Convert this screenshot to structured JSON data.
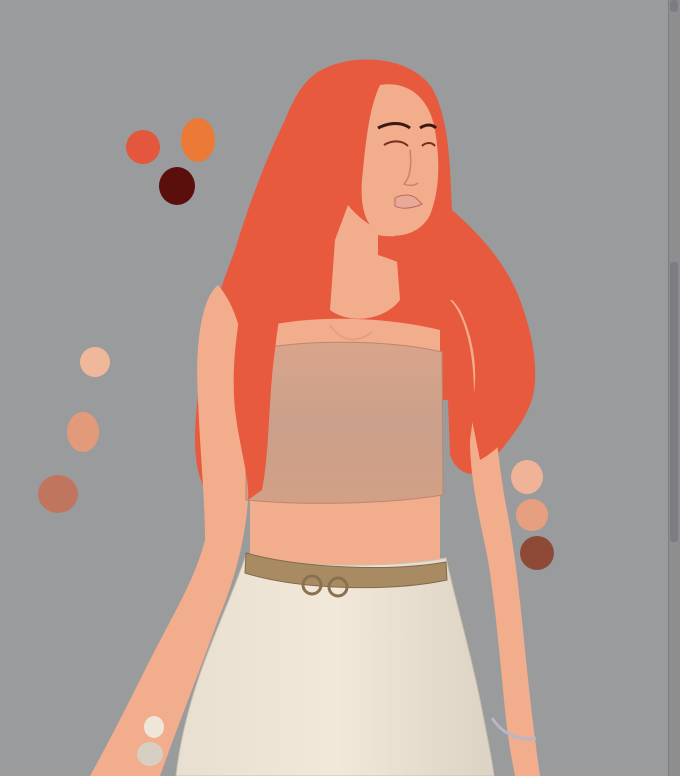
{
  "canvas": {
    "background": "#9a9b9d",
    "subject": "illustration"
  },
  "palette_swatches": [
    {
      "name": "hair-red",
      "color": "#e2573e"
    },
    {
      "name": "hair-orange",
      "color": "#ea7a35"
    },
    {
      "name": "hair-dark",
      "color": "#5a0f0c"
    },
    {
      "name": "skin-light",
      "color": "#f0b89a"
    },
    {
      "name": "skin-mid",
      "color": "#e39a7a"
    },
    {
      "name": "skin-shadow",
      "color": "#c0765e"
    },
    {
      "name": "skin-right-light",
      "color": "#efb397"
    },
    {
      "name": "skin-right-mid",
      "color": "#e6a080"
    },
    {
      "name": "skin-right-dark",
      "color": "#8e4a36"
    },
    {
      "name": "pants-light",
      "color": "#efe6d8"
    },
    {
      "name": "pants-shade",
      "color": "#d7cfc2"
    }
  ],
  "colors": {
    "hair": "#e85a3d",
    "skin": "#f2ad8c",
    "top": "#d8a48a",
    "pants": "#eee4d6",
    "belt": "#a88b62",
    "lips": "#e9a898"
  }
}
